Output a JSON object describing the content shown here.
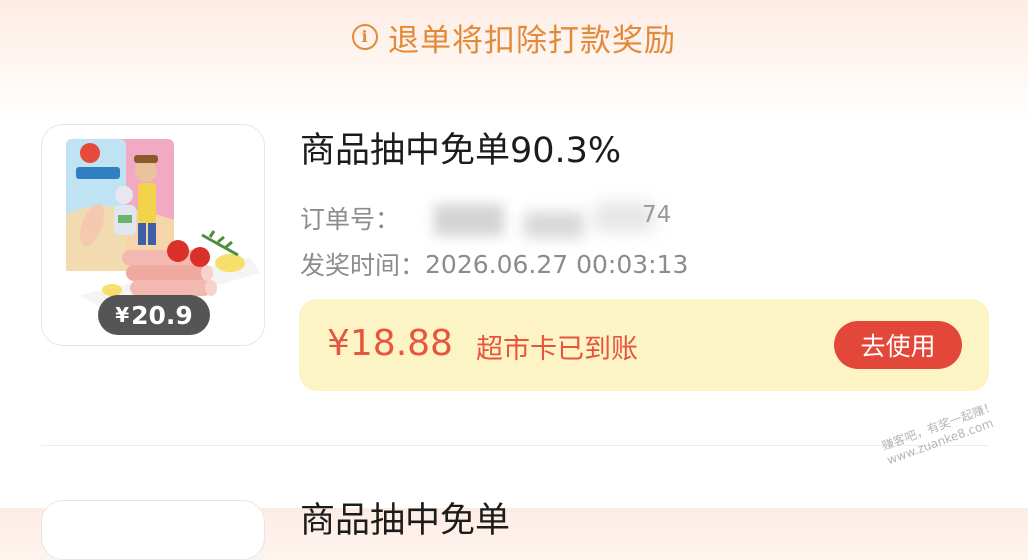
{
  "notice": {
    "icon": "info-icon",
    "text": "退单将扣除打款奖励",
    "color": "#e38a3a"
  },
  "item": {
    "product_price": "20.9",
    "currency_symbol": "¥",
    "title": "商品抽中免单90.3%",
    "order_label": "订单号：",
    "order_value_visible": "74",
    "award_time_label": "发奖时间：",
    "award_time": "2026.06.27 00:03:13",
    "reward_amount": "¥18.88",
    "reward_status": "超市卡已到账",
    "use_button_label": "去使用",
    "accent_color": "#e3473a",
    "reward_bg_color": "#fdf4c6"
  },
  "next_item": {
    "title_partial": "商品抽中免单"
  },
  "watermark": {
    "line1": "赚客吧，有奖一起赚！",
    "line2": "www.zuanke8.com"
  }
}
